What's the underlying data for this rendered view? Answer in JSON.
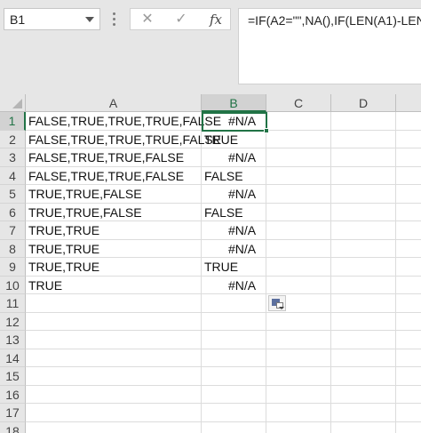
{
  "name_box": {
    "value": "B1"
  },
  "formula_bar": {
    "cancel_icon": "x-icon",
    "enter_icon": "check-icon",
    "fx_label": "fx",
    "formula": "=IF(A2=\"\",NA(),IF(LEN(A1)-LEN("
  },
  "columns": [
    "A",
    "B",
    "C",
    "D"
  ],
  "active_column": "B",
  "active_row": "1",
  "rows": [
    "1",
    "2",
    "3",
    "4",
    "5",
    "6",
    "7",
    "8",
    "9",
    "10",
    "11",
    "12",
    "13",
    "14",
    "15",
    "16",
    "17",
    "18"
  ],
  "cells": [
    {
      "row": "1",
      "a": "FALSE,TRUE,TRUE,TRUE,FALSE",
      "b": "#N/A"
    },
    {
      "row": "2",
      "a": "FALSE,TRUE,TRUE,TRUE,FALSE",
      "b": "TRUE"
    },
    {
      "row": "3",
      "a": "FALSE,TRUE,TRUE,FALSE",
      "b": "#N/A"
    },
    {
      "row": "4",
      "a": "FALSE,TRUE,TRUE,FALSE",
      "b": "FALSE"
    },
    {
      "row": "5",
      "a": "TRUE,TRUE,FALSE",
      "b": "#N/A"
    },
    {
      "row": "6",
      "a": "TRUE,TRUE,FALSE",
      "b": "FALSE"
    },
    {
      "row": "7",
      "a": "TRUE,TRUE",
      "b": "#N/A"
    },
    {
      "row": "8",
      "a": "TRUE,TRUE",
      "b": "#N/A"
    },
    {
      "row": "9",
      "a": "TRUE,TRUE",
      "b": "TRUE"
    },
    {
      "row": "10",
      "a": "TRUE",
      "b": "#N/A"
    }
  ],
  "paste_options_icon": "paste-options-icon",
  "colors": {
    "accent": "#217346",
    "header_bg": "#e6e6e6",
    "gridline": "#dcdcdc"
  }
}
